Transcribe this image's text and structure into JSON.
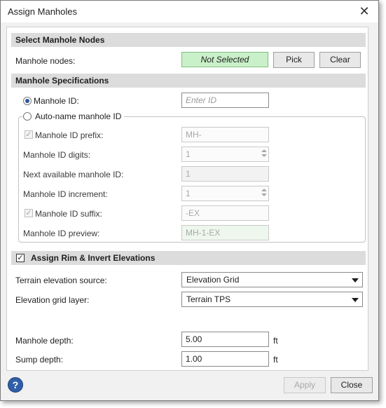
{
  "window": {
    "title": "Assign Manholes"
  },
  "select_nodes": {
    "header": "Select Manhole Nodes",
    "nodes_label": "Manhole nodes:",
    "status": "Not Selected",
    "pick_label": "Pick",
    "clear_label": "Clear"
  },
  "specs": {
    "header": "Manhole Specifications",
    "manhole_id_label": "Manhole ID:",
    "manhole_id_placeholder": "Enter ID",
    "manhole_id_selected": true,
    "auto_name_label": "Auto-name manhole ID",
    "auto_name_selected": false,
    "prefix_label": "Manhole ID prefix:",
    "prefix_value": "MH-",
    "prefix_checked": true,
    "digits_label": "Manhole ID digits:",
    "digits_value": "1",
    "next_label": "Next available manhole ID:",
    "next_value": "1",
    "increment_label": "Manhole ID increment:",
    "increment_value": "1",
    "suffix_label": "Manhole ID suffix:",
    "suffix_value": "-EX",
    "suffix_checked": true,
    "preview_label": "Manhole ID preview:",
    "preview_value": "MH-1-EX"
  },
  "elevations": {
    "header": "Assign Rim & Invert Elevations",
    "checked": true,
    "terrain_source_label": "Terrain elevation source:",
    "terrain_source_value": "Elevation Grid",
    "grid_layer_label": "Elevation grid layer:",
    "grid_layer_value": "Terrain TPS",
    "depth_label": "Manhole depth:",
    "depth_value": "5.00",
    "depth_unit": "ft",
    "sump_label": "Sump depth:",
    "sump_value": "1.00",
    "sump_unit": "ft"
  },
  "footer": {
    "help_glyph": "?",
    "apply_label": "Apply",
    "close_label": "Close"
  },
  "colors": {
    "status_bg": "#c9f0c9",
    "section_bg": "#dcdcdc",
    "help_bg": "#2f5fa8"
  }
}
